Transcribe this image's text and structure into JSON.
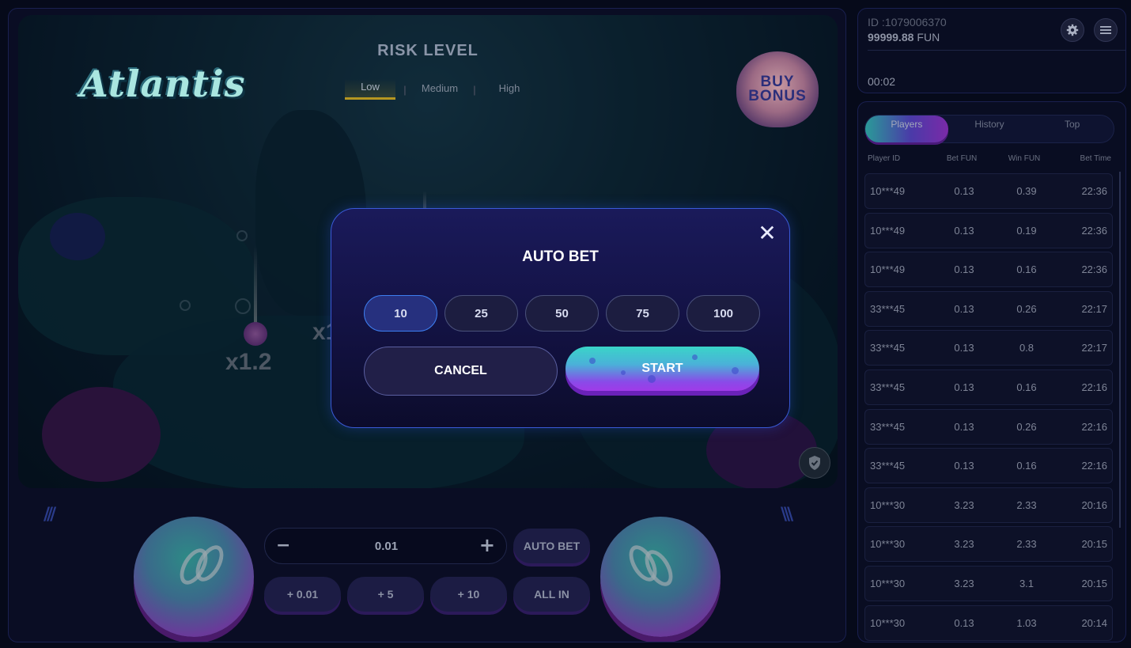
{
  "game": {
    "logo_text": "Atlantis",
    "risk_title": "RISK LEVEL",
    "risk_levels": [
      "Low",
      "Medium",
      "High"
    ],
    "active_risk": "Low",
    "buy_bonus": [
      "BUY",
      "BONUS"
    ],
    "multipliers": [
      "x1.2",
      "x1"
    ]
  },
  "controls": {
    "stake_value": "0.01",
    "minus": "−",
    "plus": "+",
    "auto_bet": "AUTO BET",
    "quick": [
      "+ 0.01",
      "+ 5",
      "+ 10",
      "ALL IN"
    ]
  },
  "account": {
    "id": "ID :1079006370",
    "balance": "99999.88",
    "currency": "FUN",
    "timer": "00:02"
  },
  "players": {
    "tabs": [
      "Players",
      "History",
      "Top"
    ],
    "active_tab": "Players",
    "headers": [
      "Player ID",
      "Bet  FUN",
      "Win  FUN",
      "Bet Time"
    ],
    "rows": [
      [
        "10***49",
        "0.13",
        "0.39",
        "22:36"
      ],
      [
        "10***49",
        "0.13",
        "0.19",
        "22:36"
      ],
      [
        "10***49",
        "0.13",
        "0.16",
        "22:36"
      ],
      [
        "33***45",
        "0.13",
        "0.26",
        "22:17"
      ],
      [
        "33***45",
        "0.13",
        "0.8",
        "22:17"
      ],
      [
        "33***45",
        "0.13",
        "0.16",
        "22:16"
      ],
      [
        "33***45",
        "0.13",
        "0.26",
        "22:16"
      ],
      [
        "33***45",
        "0.13",
        "0.16",
        "22:16"
      ],
      [
        "10***30",
        "3.23",
        "2.33",
        "20:16"
      ],
      [
        "10***30",
        "3.23",
        "2.33",
        "20:15"
      ],
      [
        "10***30",
        "3.23",
        "3.1",
        "20:15"
      ],
      [
        "10***30",
        "0.13",
        "1.03",
        "20:14"
      ]
    ]
  },
  "modal": {
    "title": "AUTO BET",
    "close": "✕",
    "counts": [
      "10",
      "25",
      "50",
      "75",
      "100"
    ],
    "selected_count": "10",
    "cancel": "CANCEL",
    "start": "START"
  },
  "colors": {
    "accent_blue": "#3d7ef0",
    "start_gradient_top": "#3ad4c8",
    "start_gradient_bottom": "#a03ae8",
    "risk_active": "#b69621"
  }
}
